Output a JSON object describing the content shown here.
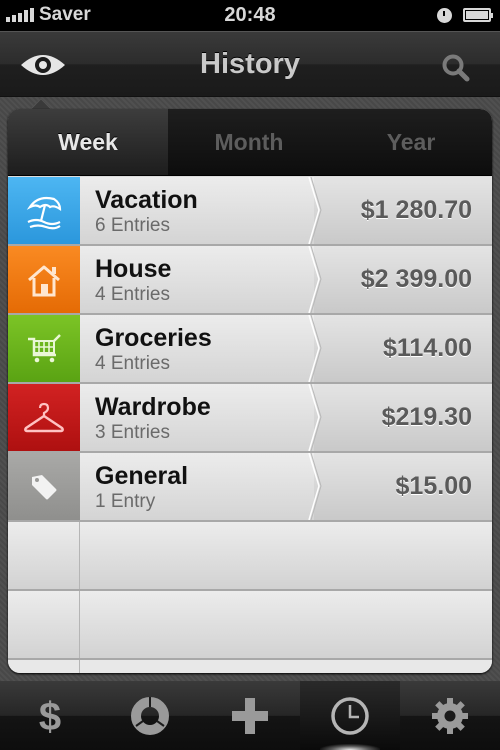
{
  "status_bar": {
    "carrier": "Saver",
    "time": "20:48",
    "signal_bars": 5,
    "battery_percent": 100
  },
  "nav": {
    "title": "History",
    "left_icon": "eye-icon",
    "right_icon": "search-icon"
  },
  "period_tabs": [
    {
      "label": "Week",
      "active": true
    },
    {
      "label": "Month",
      "active": false
    },
    {
      "label": "Year",
      "active": false
    }
  ],
  "categories": [
    {
      "name": "Vacation",
      "entries": "6 Entries",
      "amount": "$1 280.70",
      "icon": "beach-umbrella-icon",
      "color": "#3aa7ea"
    },
    {
      "name": "House",
      "entries": "4 Entries",
      "amount": "$2 399.00",
      "icon": "house-icon",
      "color": "#f07a12"
    },
    {
      "name": "Groceries",
      "entries": "4 Entries",
      "amount": "$114.00",
      "icon": "shopping-cart-icon",
      "color": "#6cb51e"
    },
    {
      "name": "Wardrobe",
      "entries": "3 Entries",
      "amount": "$219.30",
      "icon": "hanger-icon",
      "color": "#c01818"
    },
    {
      "name": "General",
      "entries": "1 Entry",
      "amount": "$15.00",
      "icon": "tag-icon",
      "color": "#9a9a98"
    }
  ],
  "tab_bar": [
    {
      "name": "expenses",
      "icon": "dollar-icon",
      "active": false
    },
    {
      "name": "statistics",
      "icon": "donut-chart-icon",
      "active": false
    },
    {
      "name": "add",
      "icon": "plus-icon",
      "active": false
    },
    {
      "name": "history",
      "icon": "clock-icon",
      "active": true
    },
    {
      "name": "settings",
      "icon": "gear-icon",
      "active": false
    }
  ]
}
